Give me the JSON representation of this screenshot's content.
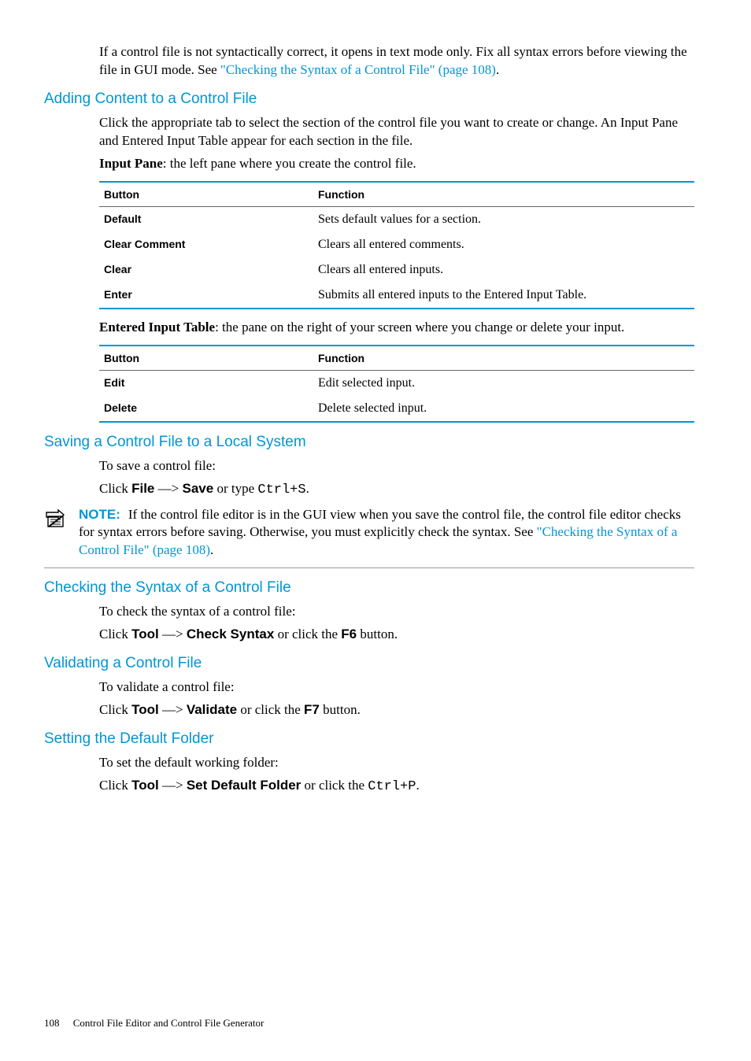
{
  "intro": {
    "p1a": "If a control file is not syntactically correct, it opens in text mode only. Fix all syntax errors before viewing the file in GUI mode. See ",
    "p1link": "\"Checking the Syntax of a Control File\" (page 108)",
    "p1b": "."
  },
  "sections": {
    "adding": {
      "title": "Adding Content to a Control File",
      "p1": "Click the appropriate tab to select the section of the control file you want to create or change. An Input Pane and Entered Input Table appear for each section in the file.",
      "p2_strong": "Input Pane",
      "p2_rest": ": the left pane where you create the control file.",
      "table1": {
        "headers": [
          "Button",
          "Function"
        ],
        "rows": [
          [
            "Default",
            "Sets default values for a section."
          ],
          [
            "Clear Comment",
            "Clears all entered comments."
          ],
          [
            "Clear",
            "Clears all entered inputs."
          ],
          [
            "Enter",
            "Submits all entered inputs to the Entered Input Table."
          ]
        ]
      },
      "p3_strong": "Entered Input Table",
      "p3_rest": ": the pane on the right of your screen where you change or delete your input.",
      "table2": {
        "headers": [
          "Button",
          "Function"
        ],
        "rows": [
          [
            "Edit",
            "Edit selected input."
          ],
          [
            "Delete",
            "Delete selected input."
          ]
        ]
      }
    },
    "saving": {
      "title": "Saving a Control File to a Local System",
      "p1": "To save a control file:",
      "p2_a": "Click ",
      "p2_b": "File",
      "p2_c": " —> ",
      "p2_d": "Save",
      "p2_e": " or type ",
      "p2_f": "Ctrl+S",
      "p2_g": "."
    },
    "note": {
      "label": "NOTE:",
      "body_a": "If the control file editor is in the GUI view when you save the control file, the control file editor checks for syntax errors before saving. Otherwise, you must explicitly check the syntax. See ",
      "body_link": "\"Checking the Syntax of a Control File\" (page 108)",
      "body_b": "."
    },
    "checking": {
      "title": "Checking the Syntax of a Control File",
      "p1": "To check the syntax of a control file:",
      "p2_a": "Click ",
      "p2_b": "Tool",
      "p2_c": " —> ",
      "p2_d": "Check Syntax",
      "p2_e": " or click the ",
      "p2_f": "F6",
      "p2_g": " button."
    },
    "validating": {
      "title": "Validating a Control File",
      "p1": "To validate a control file:",
      "p2_a": "Click ",
      "p2_b": "Tool",
      "p2_c": " —> ",
      "p2_d": "Validate",
      "p2_e": " or click the ",
      "p2_f": "F7",
      "p2_g": " button."
    },
    "setting": {
      "title": "Setting the Default Folder",
      "p1": "To set the default working folder:",
      "p2_a": "Click ",
      "p2_b": "Tool",
      "p2_c": " —> ",
      "p2_d": "Set Default Folder",
      "p2_e": " or click the ",
      "p2_f": "Ctrl+P",
      "p2_g": "."
    }
  },
  "footer": {
    "page": "108",
    "chapter": "Control File Editor and Control File Generator"
  }
}
